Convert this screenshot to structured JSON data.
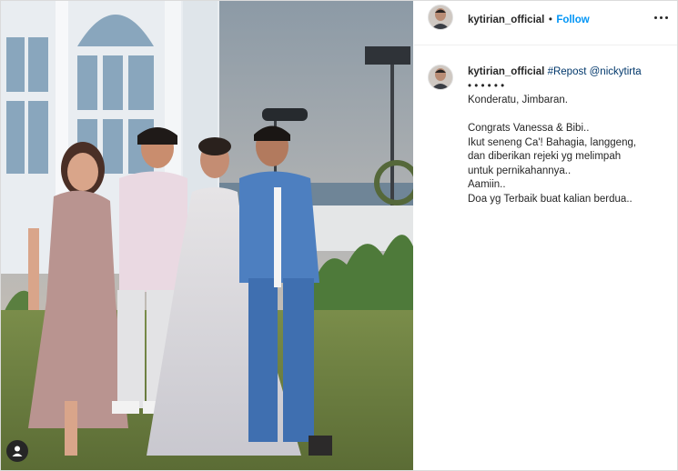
{
  "post": {
    "username": "kytirian_official",
    "separator": "•",
    "follow_label": "Follow",
    "more_icon": "more-horizontal-icon",
    "tag_icon": "user-tag-icon"
  },
  "caption": {
    "username": "kytirian_official",
    "hashtag": "#Repost",
    "mention": "@nickytirta",
    "lines": [
      "• • • • • •",
      "Konderatu, Jimbaran.",
      "",
      "Congrats Vanessa & Bibi..",
      "Ikut seneng Ca'! Bahagia, langgeng,",
      "dan diberikan rejeki yg melimpah",
      "untuk pernikahannya..",
      "Aamiin..",
      "Doa yg Terbaik buat kalian berdua.."
    ]
  },
  "colors": {
    "link_blue": "#0095f6",
    "mention_blue": "#00376b",
    "text": "#262626",
    "border": "#dbdbdb"
  }
}
